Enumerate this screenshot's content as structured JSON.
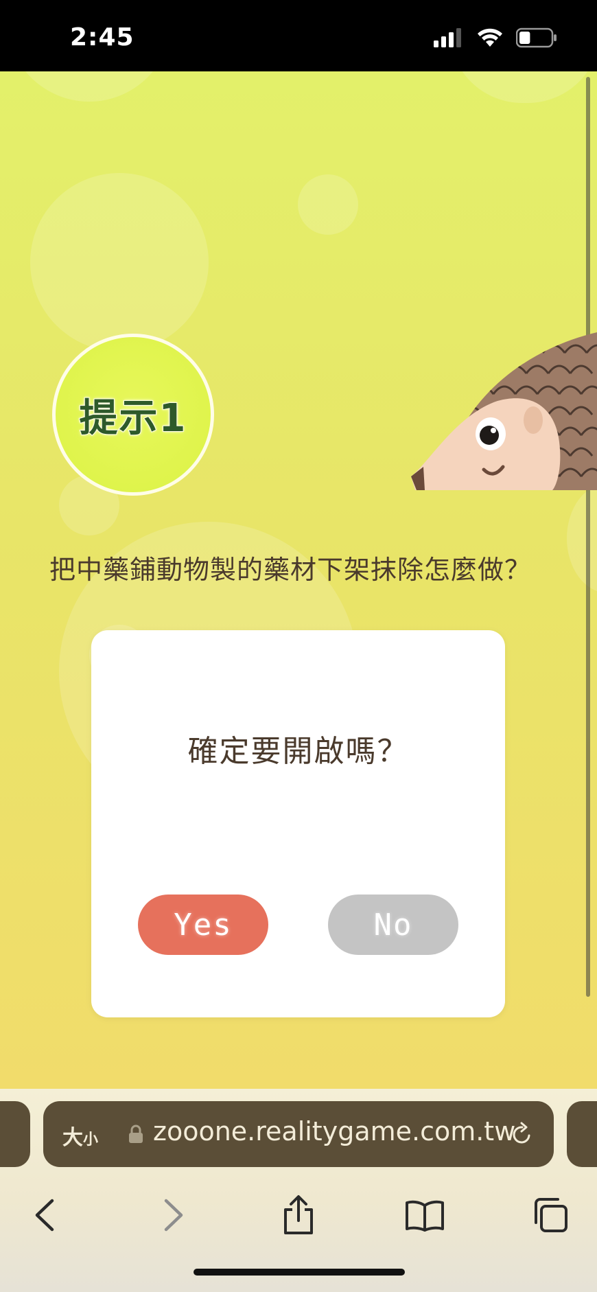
{
  "status_bar": {
    "time": "2:45",
    "icons": [
      "signal-icon",
      "wifi-icon",
      "battery-icon"
    ],
    "battery_level": 0.35
  },
  "page": {
    "hint_badge": "提示1",
    "question": "把中藥鋪動物製的藥材下架抹除怎麼做？",
    "illustration": "pangolin-illustration"
  },
  "dialog": {
    "title": "確定要開啟嗎？",
    "yes_label": "Yes",
    "no_label": "No"
  },
  "safari": {
    "text_size_label": "大",
    "text_size_small": "小",
    "url": "zooone.realitygame.com.tw",
    "toolbar_icons": [
      "back-icon",
      "forward-icon",
      "share-icon",
      "bookmarks-icon",
      "tabs-icon"
    ]
  },
  "colors": {
    "background_top": "#e3f06a",
    "background_bottom": "#f1dc6b",
    "yes_button": "#e6715c",
    "no_button": "#c4c4c4",
    "badge_text": "#2e5a2a",
    "text": "#4a3a2c",
    "address_bar": "#5b4e37"
  }
}
